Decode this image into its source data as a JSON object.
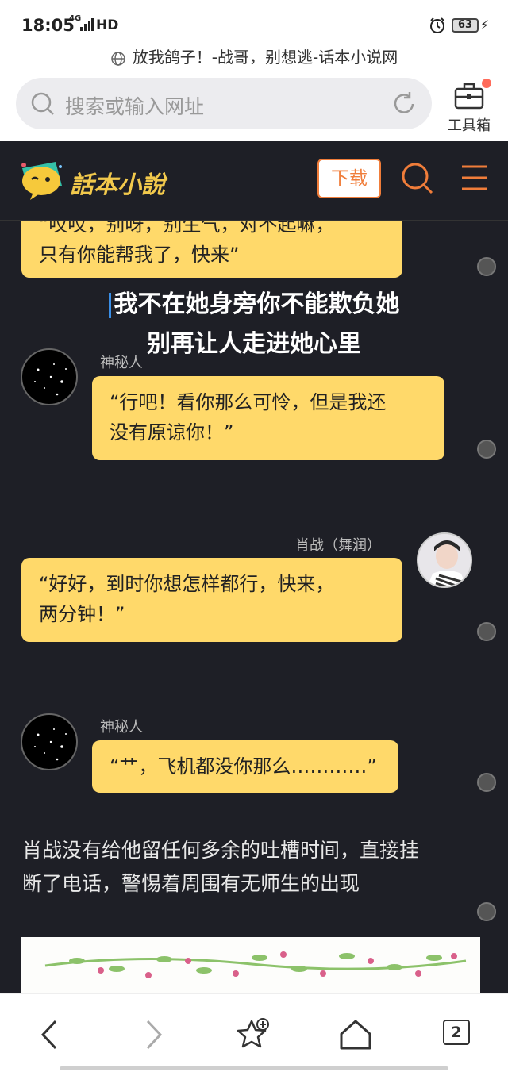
{
  "status_bar": {
    "time": "18:05",
    "network": "4G",
    "hd": "HD",
    "battery": "63"
  },
  "browser": {
    "page_title": "放我鸽子！-战哥，别想逃-话本小说网",
    "search_placeholder": "搜索或输入网址",
    "toolbox_label": "工具箱"
  },
  "site_header": {
    "logo_text": "話本小說",
    "download_label": "下载"
  },
  "chat": {
    "top_bubble_partial": "“哎哎，别呀，别生气，对不起嘛，",
    "top_bubble_line2": "只有你能帮我了，快来”",
    "lyric_line1": "我不在她身旁你不能欺负她",
    "lyric_line2": "别再让人走进她心里",
    "msg1": {
      "name": "神秘人",
      "line1": "“行吧！看你那么可怜，但是我还",
      "line2": "没有原谅你！”"
    },
    "msg2": {
      "name": "肖战（舞润）",
      "line1": "“好好，到时你想怎样都行，快来，",
      "line2": "两分钟！”"
    },
    "msg3": {
      "name": "神秘人",
      "line1": "“艹，飞机都没你那么…………”"
    }
  },
  "narration": {
    "line1": "肖战没有给他留任何多余的吐槽时间，直接挂",
    "line2": "断了电话，警惕着周围有无师生的出现"
  },
  "bottom_nav": {
    "tab_count": "2"
  },
  "colors": {
    "bubble": "#ffd96a",
    "background": "#1e1f26",
    "accent": "#f07d3a"
  }
}
